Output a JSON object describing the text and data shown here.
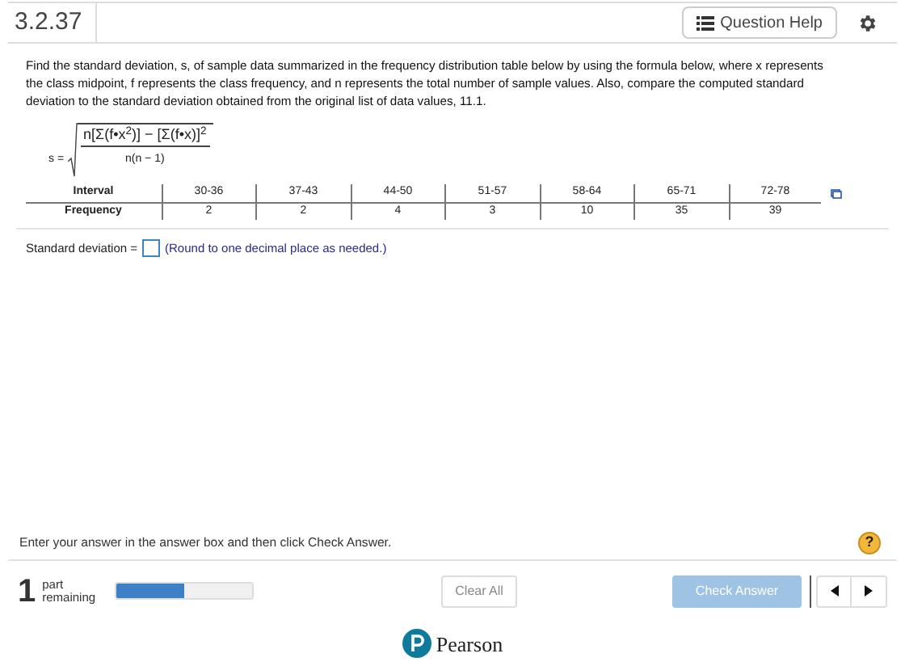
{
  "header": {
    "title": "3.2.37",
    "help_button": "Question Help"
  },
  "question": {
    "text": "Find the standard deviation, s, of sample data summarized in the frequency distribution table below by using the formula below, where x represents the class midpoint, f represents the class frequency, and n represents the total number of sample values. Also, compare the computed standard deviation to the standard deviation obtained from the original list of data values, 11.1."
  },
  "formula": {
    "lhs": "s =",
    "numerator": "n[Σ(f•x$^{2}$)] − [Σ(f•x)]$^{2}$",
    "denominator": "n(n − 1)"
  },
  "table": {
    "row_headers": [
      "Interval",
      "Frequency"
    ],
    "columns": [
      {
        "interval": "30-36",
        "frequency": "2"
      },
      {
        "interval": "37-43",
        "frequency": "2"
      },
      {
        "interval": "44-50",
        "frequency": "4"
      },
      {
        "interval": "51-57",
        "frequency": "3"
      },
      {
        "interval": "58-64",
        "frequency": "10"
      },
      {
        "interval": "65-71",
        "frequency": "35"
      },
      {
        "interval": "72-78",
        "frequency": "39"
      }
    ]
  },
  "answer": {
    "label": "Standard deviation =",
    "hint": "(Round to one decimal place as needed.)"
  },
  "instructions": "Enter your answer in the answer box and then click Check Answer.",
  "help_icon": "?",
  "footer": {
    "parts_count": "1",
    "parts_label": "part remaining",
    "level": 0.5,
    "clear_button": "Clear All",
    "check_button": {
      "label": "Check Answer",
      "disabled": true
    }
  },
  "brand": {
    "name": "Pearson"
  }
}
